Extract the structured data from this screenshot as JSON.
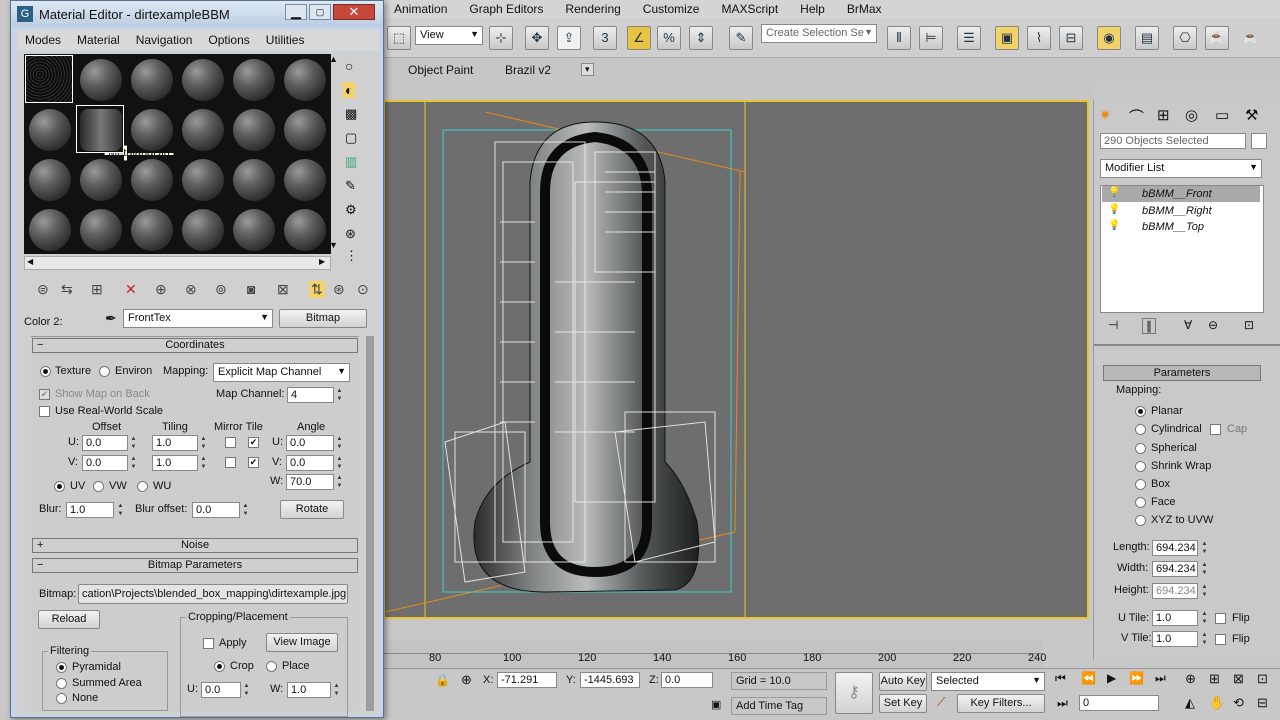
{
  "menubar": [
    "Animation",
    "Graph Editors",
    "Rendering",
    "Customize",
    "MAXScript",
    "Help",
    "BrMax"
  ],
  "toolbar": {
    "view_combo": "View",
    "selection_set_placeholder": "Create Selection Se"
  },
  "ribbon": {
    "tabs": [
      "Object Paint",
      "Brazil v2"
    ]
  },
  "material_editor": {
    "title": "Material Editor - dirtexampleBBM",
    "menu": [
      "Modes",
      "Material",
      "Navigation",
      "Options",
      "Utilities"
    ],
    "tooltip": "MetalandDirt",
    "color_label": "Color 2:",
    "map_name": "FrontTex",
    "map_type": "Bitmap",
    "coordinates": {
      "title": "Coordinates",
      "texture": "Texture",
      "environ": "Environ",
      "mapping_label": "Mapping:",
      "mapping_value": "Explicit Map Channel",
      "show_map_on_back": "Show Map on Back",
      "map_channel_label": "Map Channel:",
      "map_channel": "4",
      "real_world": "Use Real-World Scale",
      "offset": "Offset",
      "tiling": "Tiling",
      "mirror_tile": "Mirror Tile",
      "angle": "Angle",
      "u_label": "U:",
      "v_label": "V:",
      "w_label": "W:",
      "u_offset": "0.0",
      "v_offset": "0.0",
      "u_tiling": "1.0",
      "v_tiling": "1.0",
      "u_angle": "0.0",
      "v_angle": "0.0",
      "w_angle": "70.0",
      "uv": "UV",
      "vw": "VW",
      "wu": "WU",
      "blur_label": "Blur:",
      "blur": "1.0",
      "blur_offset_label": "Blur offset:",
      "blur_offset": "0.0",
      "rotate": "Rotate"
    },
    "noise": "Noise",
    "bitmap_params": {
      "title": "Bitmap Parameters",
      "bitmap_label": "Bitmap:",
      "path": "cation\\Projects\\blended_box_mapping\\dirtexample.jpg",
      "reload": "Reload",
      "cropping": "Cropping/Placement",
      "apply": "Apply",
      "view_image": "View Image",
      "crop": "Crop",
      "place": "Place",
      "u": "U:",
      "u_val": "0.0",
      "w": "W:",
      "w_val": "1.0",
      "filtering": "Filtering",
      "pyramidal": "Pyramidal",
      "summed_area": "Summed Area",
      "none": "None"
    }
  },
  "command_panel": {
    "selection": "290 Objects Selected",
    "modifier_list": "Modifier List",
    "modifiers": [
      "bBMM__Front",
      "bBMM__Right",
      "bBMM__Top"
    ],
    "parameters": "Parameters",
    "mapping": "Mapping:",
    "options": [
      "Planar",
      "Cylindrical",
      "Spherical",
      "Shrink Wrap",
      "Box",
      "Face",
      "XYZ to UVW"
    ],
    "cap": "Cap",
    "length_label": "Length:",
    "length": "694.234",
    "width_label": "Width:",
    "width": "694.234",
    "height_label": "Height:",
    "height": "694.234",
    "utile_label": "U Tile:",
    "utile": "1.0",
    "vtile_label": "V Tile:",
    "vtile": "1.0",
    "flip": "Flip"
  },
  "timeline": {
    "ticks": [
      "80",
      "100",
      "120",
      "140",
      "160",
      "180",
      "200",
      "220",
      "240"
    ]
  },
  "status": {
    "x_label": "X:",
    "x": "-71.291",
    "y_label": "Y:",
    "y": "-1445.693",
    "z_label": "Z:",
    "z": "0.0",
    "grid": "Grid = 10.0",
    "add_time_tag": "Add Time Tag",
    "auto_key": "Auto Key",
    "set_key": "Set Key",
    "selected": "Selected",
    "key_filters": "Key Filters...",
    "frame": "0"
  }
}
